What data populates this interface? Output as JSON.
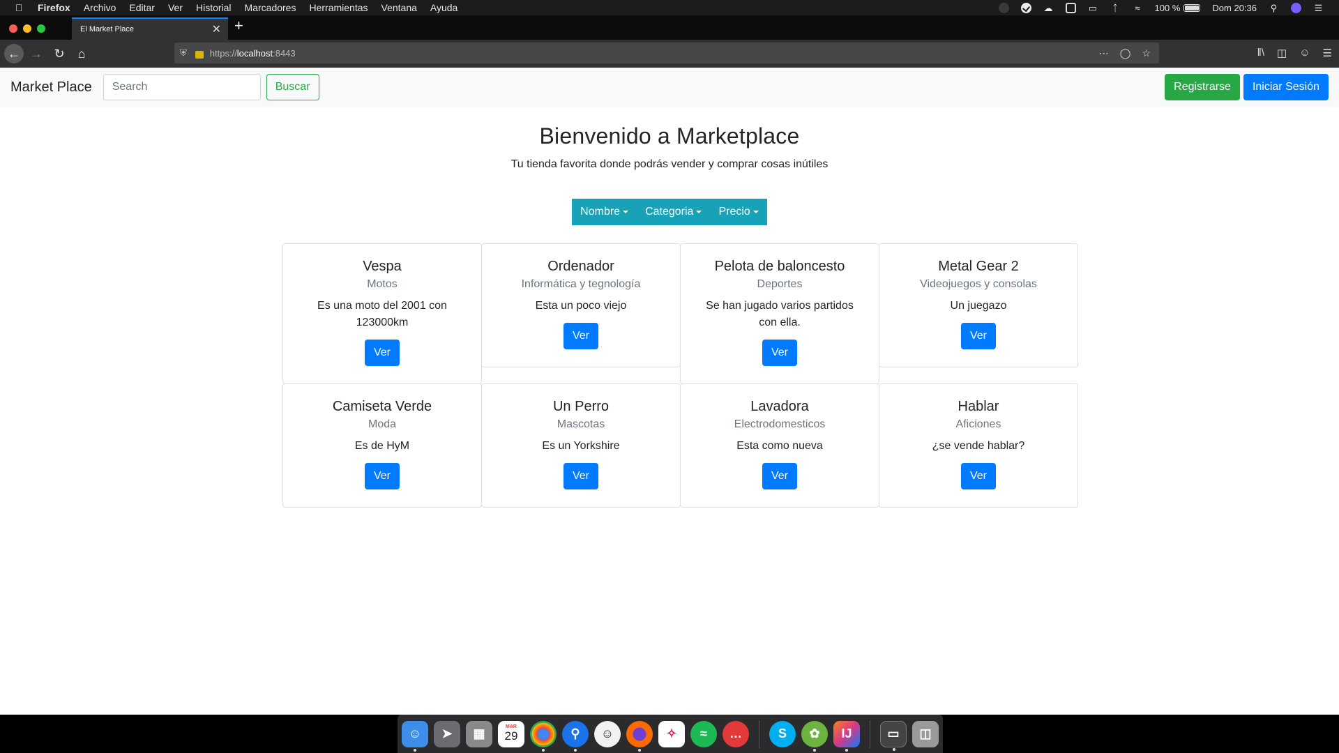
{
  "menubar": {
    "app_name": "Firefox",
    "menus": [
      "Archivo",
      "Editar",
      "Ver",
      "Historial",
      "Marcadores",
      "Herramientas",
      "Ventana",
      "Ayuda"
    ],
    "battery": "100 %",
    "clock": "Dom 20:36"
  },
  "browser": {
    "tab_title": "El Market Place",
    "url_prefix": "https://",
    "url_host": "localhost",
    "url_port": ":8443"
  },
  "site": {
    "brand": "Market Place",
    "search_placeholder": "Search",
    "search_button": "Buscar",
    "register_button": "Registrarse",
    "login_button": "Iniciar Sesión"
  },
  "hero": {
    "title": "Bienvenido a Marketplace",
    "subtitle": "Tu tienda favorita donde podrás vender y comprar cosas inútiles"
  },
  "filters": [
    "Nombre",
    "Categoria",
    "Precio"
  ],
  "products": [
    {
      "title": "Vespa",
      "category": "Motos",
      "description": "Es una moto del 2001 con 123000km",
      "button": "Ver"
    },
    {
      "title": "Ordenador",
      "category": "Informática y tegnología",
      "description": "Esta un poco viejo",
      "button": "Ver"
    },
    {
      "title": "Pelota de baloncesto",
      "category": "Deportes",
      "description": "Se han jugado varios partidos con ella.",
      "button": "Ver"
    },
    {
      "title": "Metal Gear 2",
      "category": "Videojuegos y consolas",
      "description": "Un juegazo",
      "button": "Ver"
    },
    {
      "title": "Camiseta Verde",
      "category": "Moda",
      "description": "Es de HyM",
      "button": "Ver"
    },
    {
      "title": "Un Perro",
      "category": "Mascotas",
      "description": "Es un Yorkshire",
      "button": "Ver"
    },
    {
      "title": "Lavadora",
      "category": "Electrodomesticos",
      "description": "Esta como nueva",
      "button": "Ver"
    },
    {
      "title": "Hablar",
      "category": "Aficiones",
      "description": "¿se vende hablar?",
      "button": "Ver"
    }
  ],
  "dock": {
    "calendar_month": "MAR",
    "calendar_day": "29",
    "apps": [
      "finder-icon",
      "launchpad-icon",
      "calculator-icon",
      "calendar-icon",
      "chrome-icon",
      "maps-icon",
      "emoji-icon",
      "firefox-icon",
      "slack-icon",
      "spotify-icon",
      "messages-icon",
      "skype-icon",
      "spring-icon",
      "intellij-icon",
      "screen-icon",
      "trash-icon"
    ]
  }
}
